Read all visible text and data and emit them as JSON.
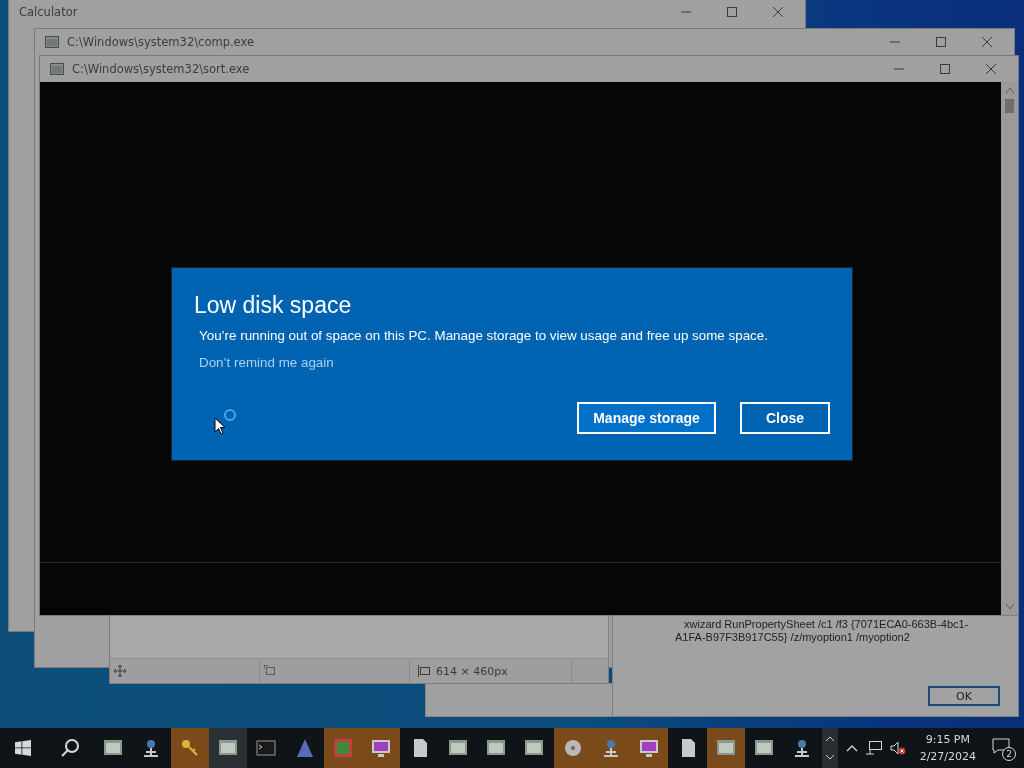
{
  "windows": [
    {
      "title": "Calculator"
    },
    {
      "title": "C:\\Windows\\system32\\comp.exe"
    },
    {
      "title": "C:\\Windows\\system32\\sort.exe"
    }
  ],
  "paint_status": {
    "size": "614 × 460px"
  },
  "xwizard": {
    "message": "xwizard RunPropertySheet /c1 /f3 {7071ECA0-663B-4bc1-A1FA-B97F3B917C55} /z/myoption1 /myoption2",
    "button": "OK"
  },
  "dialog": {
    "title": "Low disk space",
    "message": "You’re running out of space on this PC. Manage storage to view usage and free up some space.",
    "link": "Don’t remind me again",
    "buttons": [
      {
        "label": "Manage storage",
        "primary": true
      },
      {
        "label": "Close",
        "primary": false
      }
    ]
  },
  "taskbar": {
    "apps": [
      {
        "highlighted": false,
        "active": false
      },
      {
        "highlighted": false,
        "active": false
      },
      {
        "highlighted": true,
        "active": false
      },
      {
        "highlighted": false,
        "active": true
      },
      {
        "highlighted": false,
        "active": false
      },
      {
        "highlighted": false,
        "active": false
      },
      {
        "highlighted": true,
        "active": false
      },
      {
        "highlighted": true,
        "active": false
      },
      {
        "highlighted": false,
        "active": false
      },
      {
        "highlighted": false,
        "active": false
      },
      {
        "highlighted": false,
        "active": false
      },
      {
        "highlighted": false,
        "active": false
      },
      {
        "highlighted": true,
        "active": false
      },
      {
        "highlighted": true,
        "active": false
      },
      {
        "highlighted": true,
        "active": false
      },
      {
        "highlighted": false,
        "active": false
      },
      {
        "highlighted": true,
        "active": false
      },
      {
        "highlighted": false,
        "active": false
      },
      {
        "highlighted": false,
        "active": false
      }
    ],
    "time": "9:15 PM",
    "date": "2/27/2024",
    "notifications": "2"
  }
}
